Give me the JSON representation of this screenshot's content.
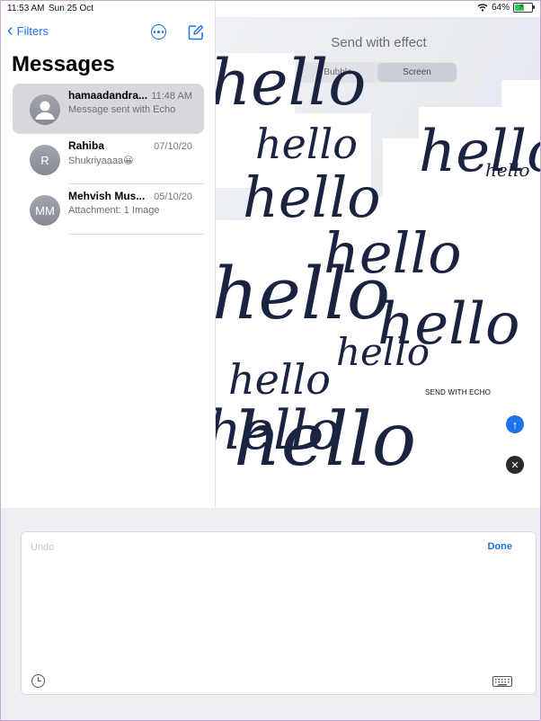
{
  "status_bar": {
    "time": "11:53 AM",
    "date": "Sun 25 Oct",
    "battery": "64%",
    "battery_level": 0.64
  },
  "sidebar": {
    "back_label": "Filters",
    "title": "Messages",
    "conversations": [
      {
        "name": "hamaadandra...",
        "time": "11:48 AM",
        "preview": "Message sent with Echo",
        "initials": "",
        "selected": true
      },
      {
        "name": "Rahiba",
        "time": "07/10/20",
        "preview": "Shukriyaaaa😀",
        "initials": "R",
        "selected": false
      },
      {
        "name": "Mehvish Mus...",
        "time": "05/10/20",
        "preview": "Attachment: 1 Image",
        "initials": "MM",
        "selected": false
      }
    ]
  },
  "effect_panel": {
    "title": "Send with effect",
    "tabs": [
      {
        "label": "Bubble",
        "active": false
      },
      {
        "label": "Screen",
        "active": true
      }
    ],
    "effect_label": "SEND WITH ECHO",
    "echo_word": "hello"
  },
  "keyboard_panel": {
    "undo_label": "Undo",
    "done_label": "Done"
  },
  "icons": {
    "back": "chevron-left-icon",
    "more": "ellipsis-circle-icon",
    "compose": "compose-icon",
    "wifi": "wifi-icon",
    "battery": "battery-charging-icon",
    "send": "arrow-up-icon",
    "cancel": "close-icon",
    "history": "clock-icon",
    "keyboard": "keyboard-icon"
  },
  "colors": {
    "accent": "#1a73e8",
    "selected_row": "#d7d7dc",
    "battery": "#34c759"
  }
}
